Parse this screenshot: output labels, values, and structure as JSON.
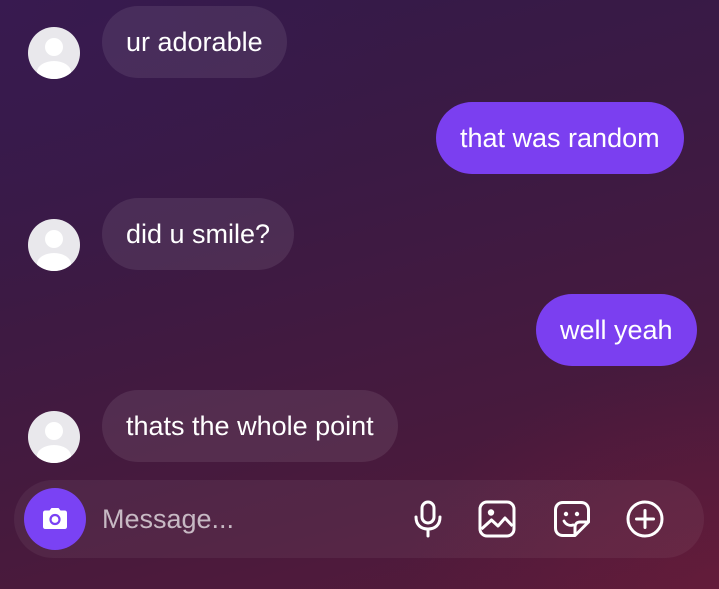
{
  "thread": {
    "messages": [
      {
        "direction": "incoming",
        "text": "ur adorable"
      },
      {
        "direction": "outgoing",
        "text": "that was random"
      },
      {
        "direction": "incoming",
        "text": "did u smile?"
      },
      {
        "direction": "outgoing",
        "text": "well yeah"
      },
      {
        "direction": "incoming",
        "text": "thats the whole point"
      }
    ]
  },
  "composer": {
    "placeholder": "Message...",
    "icons": [
      "camera-icon",
      "microphone-icon",
      "gallery-icon",
      "sticker-icon",
      "plus-circle-icon"
    ]
  },
  "colors": {
    "outgoing_bubble": "#7b3ff0",
    "camera_button": "#7a42f4",
    "background_top": "#331a4a",
    "background_bottom": "#561b3a"
  }
}
